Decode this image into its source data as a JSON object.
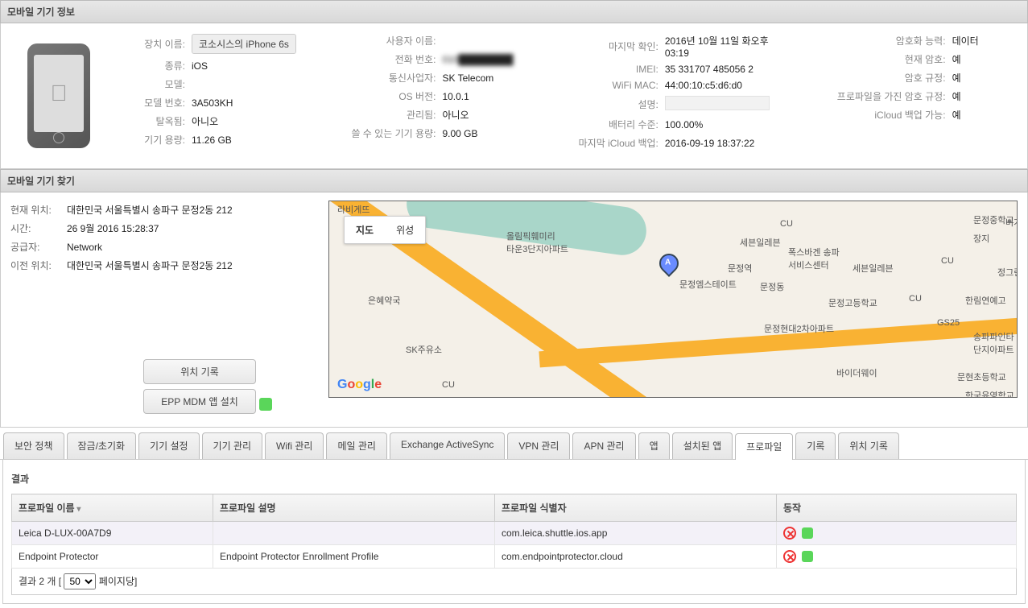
{
  "info": {
    "title": "모바일 기기 정보",
    "labels": {
      "device_name": "장치 이름:",
      "type": "종류:",
      "model": "모델:",
      "model_no": "모델 번호:",
      "jailbroken": "탈옥됨:",
      "capacity": "기기 용량:",
      "user_name": "사용자 이름:",
      "phone": "전화 번호:",
      "carrier": "통신사업자:",
      "os": "OS 버전:",
      "managed": "관리됨:",
      "avail": "쓸 수 있는 기기 용량:",
      "last_check": "마지막 확인:",
      "imei": "IMEI:",
      "wifi": "WiFi MAC:",
      "desc": "설명:",
      "battery": "배터리 수준:",
      "icloud": "마지막 iCloud 백업:",
      "enc_cap": "암호화 능력:",
      "enc_cur": "현재 암호:",
      "enc_reg": "암호 규정:",
      "enc_prof": "프로파일을 가진 암호 규정:",
      "icloud_avail": "iCloud 백업 가능:"
    },
    "values": {
      "device_name": "코소시스의 iPhone 6s",
      "type": "iOS",
      "model": "",
      "model_no": "3A503KH",
      "jailbroken": "아니오",
      "capacity": "11.26 GB",
      "user_name": "",
      "phone": "010████████",
      "carrier": "SK Telecom",
      "os": "10.0.1",
      "managed": "아니오",
      "avail": "9.00 GB",
      "last_check": "2016년 10월 11일 화오후 03:19",
      "imei": "35 331707 485056 2",
      "wifi": "44:00:10:c5:d6:d0",
      "desc": "",
      "battery": "100.00%",
      "icloud": "2016-09-19 18:37:22",
      "enc_cap": "데이터",
      "enc_cur": "예",
      "enc_reg": "예",
      "enc_prof": "예",
      "icloud_avail": "예"
    }
  },
  "find": {
    "title": "모바일 기기 찾기",
    "labels": {
      "cur": "현재 위치:",
      "time": "시간:",
      "provider": "공급자:",
      "prev": "이전 위치:"
    },
    "values": {
      "cur": "대한민국 서울특별시 송파구 문정2동 212",
      "time": "26 9월 2016 15:28:37",
      "provider": "Network",
      "prev": "대한민국 서울특별시 송파구 문정2동 212"
    },
    "btn_history": "위치 기록",
    "btn_install": "EPP MDM 앱 설치",
    "map": {
      "map": "지도",
      "sat": "위성",
      "marker": "A",
      "poi": {
        "a": "올림픽훼미리\n타운3단지아파트",
        "b": "문정엠스테이트",
        "c": "문정역",
        "d": "문정동",
        "e": "세븐일레븐",
        "f": "폭스바겐 송파\n서비스센터",
        "g": "세븐일레븐",
        "h": "문정중학교",
        "i": "버거킹",
        "j": "정그린",
        "k": "문정고등학교",
        "l": "한림연예고",
        "m": "문정현대2차아파트",
        "n": "GS25",
        "o": "송파파인타\n단지아파트",
        "p": "바이더웨이",
        "q": "문현초등학교",
        "r": "한국육영학교",
        "s": "은혜약국",
        "t": "라비게뜨",
        "u": "CU",
        "v": "CU",
        "w": "CU",
        "x": "CU",
        "y": "장지",
        "z": "SK주유소"
      }
    }
  },
  "tabs": [
    "보안 정책",
    "잠금/초기화",
    "기기 설정",
    "기기 관리",
    "Wifi 관리",
    "메일 관리",
    "Exchange ActiveSync",
    "VPN 관리",
    "APN 관리",
    "앱",
    "설치된 앱",
    "프로파일",
    "기록",
    "위치 기록"
  ],
  "active_tab": 11,
  "results": {
    "title": "결과",
    "headers": {
      "name": "프로파일 이름",
      "desc": "프로파일 설명",
      "id": "프로파일 식별자",
      "action": "동작"
    },
    "rows": [
      {
        "name": "Leica D-LUX-00A7D9",
        "desc": "",
        "id": "com.leica.shuttle.ios.app"
      },
      {
        "name": "Endpoint Protector",
        "desc": "Endpoint Protector Enrollment Profile",
        "id": "com.endpointprotector.cloud"
      }
    ],
    "pager": {
      "prefix": "결과 2 개  [",
      "page_size": "50",
      "suffix": "페이지당]"
    }
  }
}
